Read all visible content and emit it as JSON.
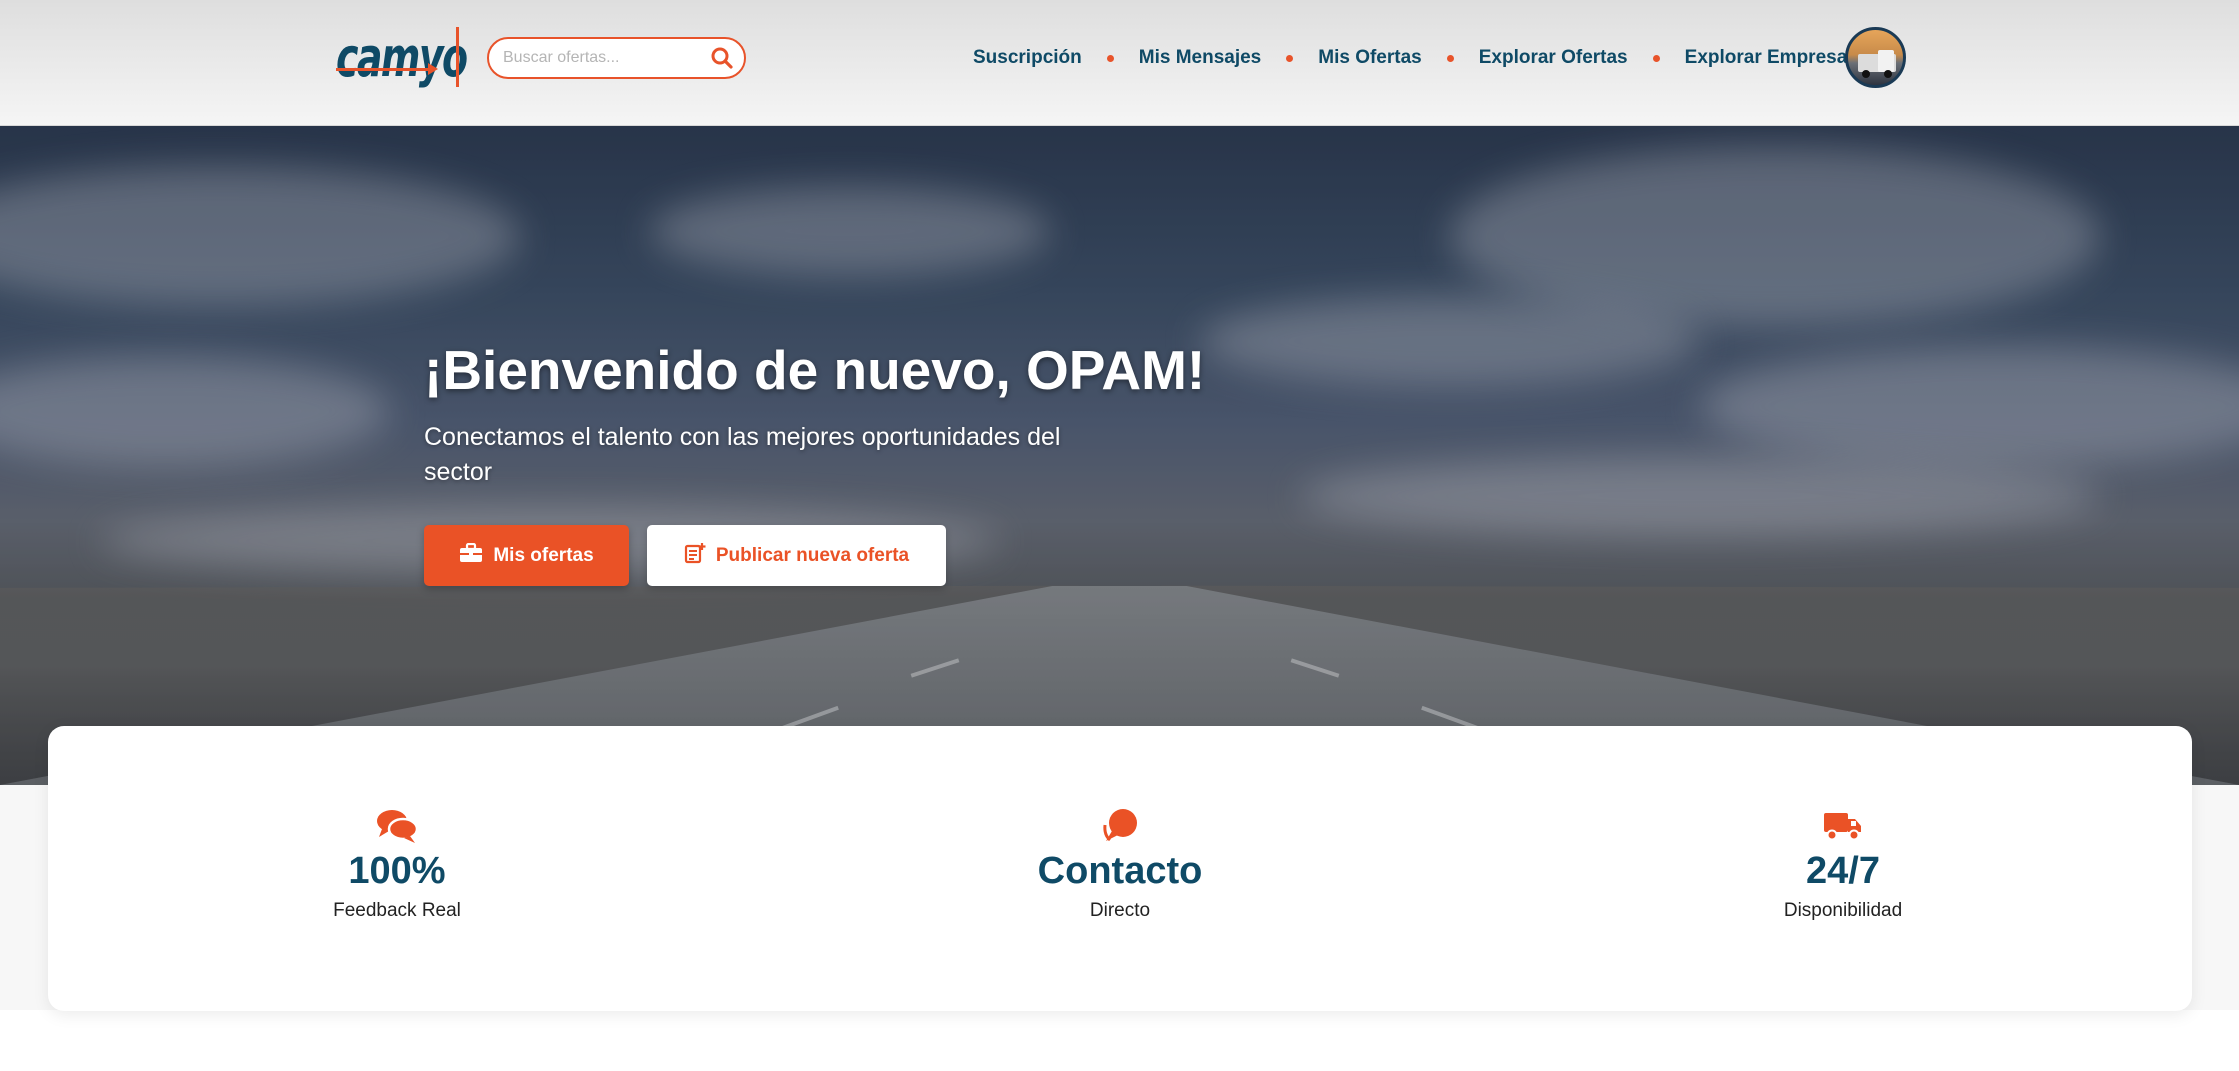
{
  "header": {
    "logo_text": "camyo",
    "search": {
      "placeholder": "Buscar ofertas..."
    },
    "nav": [
      {
        "label": "Suscripción"
      },
      {
        "label": "Mis Mensajes"
      },
      {
        "label": "Mis Ofertas"
      },
      {
        "label": "Explorar Ofertas"
      },
      {
        "label": "Explorar Empresas"
      }
    ]
  },
  "hero": {
    "title": "¡Bienvenido de nuevo, OPAM!",
    "subtitle": "Conectamos el talento con las mejores oportunidades del sector",
    "primary_button": "Mis ofertas",
    "secondary_button": "Publicar nueva oferta"
  },
  "stats": [
    {
      "icon": "comments-icon",
      "value": "100%",
      "label": "Feedback Real"
    },
    {
      "icon": "chat-bubble-icon",
      "value": "Contacto",
      "label": "Directo"
    },
    {
      "icon": "truck-icon",
      "value": "24/7",
      "label": "Disponibilidad"
    }
  ],
  "colors": {
    "accent": "#ea5226",
    "brand_navy": "#0f4a66",
    "white": "#ffffff"
  }
}
